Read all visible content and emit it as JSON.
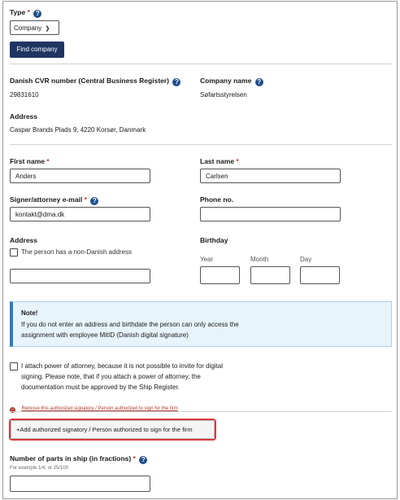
{
  "type_field": {
    "label": "Type",
    "required": "*",
    "help": "?",
    "select_value": "Company",
    "find_button": "Find company"
  },
  "company": {
    "cvr_label": "Danish CVR number (Central Business Register)",
    "cvr_value": "29831610",
    "name_label": "Company name",
    "name_value": "Søfartsstyrelsen",
    "address_label": "Address",
    "address_value": "Caspar Brands Plads 9, 4220 Korsør, Danmark",
    "help": "?"
  },
  "person": {
    "first_name_label": "First name",
    "first_name_value": "Anders",
    "last_name_label": "Last name",
    "last_name_value": "Carlsen",
    "email_label": "Signer/attorney e-mail",
    "email_value": "kontakt@dma.dk",
    "phone_label": "Phone no.",
    "phone_value": "",
    "address_label": "Address",
    "non_danish_label": "The person has a non-Danish address",
    "address_value": "",
    "birthday_label": "Birthday",
    "year_label": "Year",
    "month_label": "Month",
    "day_label": "Day",
    "year_value": "",
    "month_value": "",
    "day_value": "",
    "required": "*",
    "help": "?"
  },
  "note": {
    "title": "Note!",
    "line1": "If you do not enter an address and birthdate the person can only access the",
    "line2": "assignment with employee MitID (Danish digital signature)"
  },
  "attach": {
    "line1": "I attach power of attorney, because it is not possible to invite for digital",
    "line2": "signing. Please note, that if you attach a power of attorney, the",
    "line3": "documentation must be approved by the Ship Register."
  },
  "remove_link": "Remove this authorized signatory / Person authorized to sign for the firm",
  "add_button": "+Add authorized signatory / Person authorized to sign for the firm",
  "parts": {
    "label": "Number of parts in ship (in fractions)",
    "required": "*",
    "help": "?",
    "hint": "For example 1/4, or 25/100",
    "value": ""
  }
}
